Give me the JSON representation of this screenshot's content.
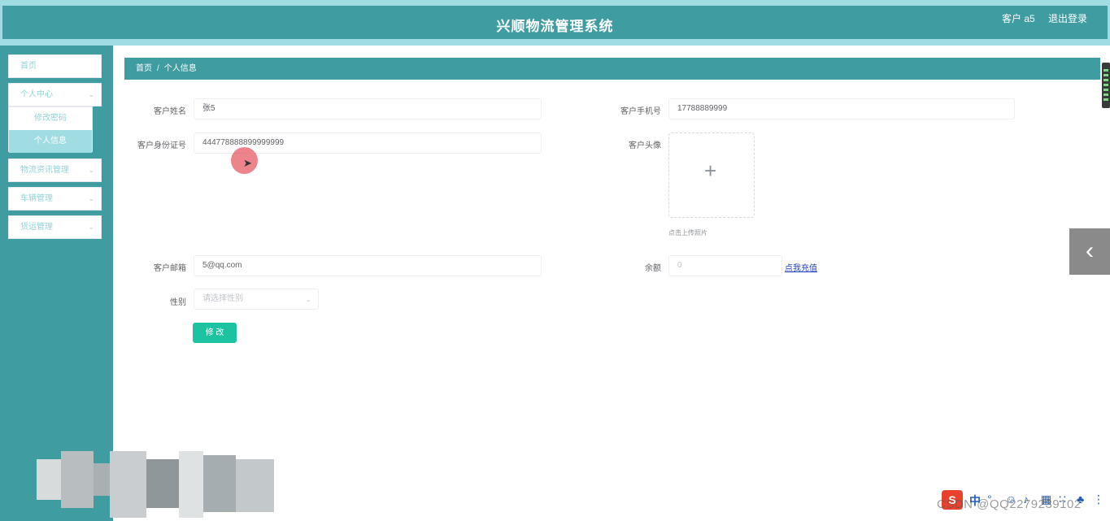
{
  "header": {
    "title": "兴顺物流管理系统",
    "user_label": "客户 a5",
    "logout_label": "退出登录"
  },
  "sidebar": {
    "items": [
      {
        "label": "首页",
        "chevron": ""
      },
      {
        "label": "个人中心",
        "chevron": "⌄"
      },
      {
        "label": "物流资讯管理",
        "chevron": "⌄"
      },
      {
        "label": "车辆管理",
        "chevron": "⌄"
      },
      {
        "label": "货运管理",
        "chevron": "⌄"
      }
    ],
    "submenu": [
      {
        "label": "修改密码"
      },
      {
        "label": "个人信息",
        "active": true
      }
    ]
  },
  "breadcrumb": {
    "home": "首页",
    "separator": "/",
    "current": "个人信息"
  },
  "form": {
    "name_label": "客户姓名",
    "name_value": "张5",
    "phone_label": "客户手机号",
    "phone_value": "17788889999",
    "idcard_label": "客户身份证号",
    "idcard_value": "444778888899999999",
    "avatar_label": "客户头像",
    "avatar_plus": "+",
    "upload_tip": "点击上传照片",
    "email_label": "客户邮箱",
    "email_value": "5@qq.com",
    "balance_label": "余额",
    "balance_value": "0",
    "recharge_label": "点我充值",
    "gender_label": "性别",
    "gender_placeholder": "请选择性别",
    "submit_label": "修 改"
  },
  "overlay": {
    "side_arrow": "‹",
    "tray_logo": "S",
    "tray_lang": "中",
    "watermark": "CSDN @QQ2279239102"
  },
  "colors": {
    "theme": "#3f9da2",
    "theme_light": "#9fdde2",
    "button": "#1cc3a0",
    "link": "#1d3fc2"
  }
}
